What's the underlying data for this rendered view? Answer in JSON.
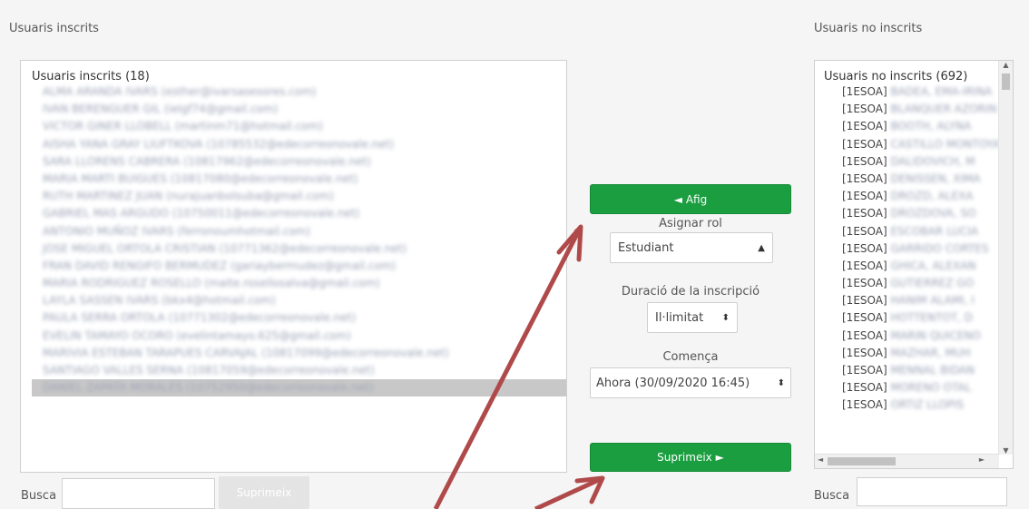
{
  "enrolled": {
    "panel_title": "Usuaris inscrits",
    "list_header": "Usuaris inscrits (18)",
    "items": [
      "ALMA ARANDA IVARS (esther@ivarsasesores.com)",
      "IVAN BERENGUER GIL (ielgf74@gmail.com)",
      "VICTOR GINER LLOBELL (martinm71@hotmail.com)",
      "AISHA YANA GRAY LIUFTKOVA (10785532@edecorreonovale.net)",
      "SARA LLORENS CABRERA (10817962@edecorreonovale.net)",
      "MARIA MARTI BUIGUES (10817080@edecorreonovale.net)",
      "RUTH MARTINEZ JUAN (nurajuanbolsuba@gmail.com)",
      "GABRIEL MAS ARGUDO (10750011@edecorreonovale.net)",
      "ANTONIO MUÑOZ IVARS (ferronoumhotmail.com)",
      "JOSE MIGUEL ORTOLA CRISTIAN (10771362@edecorreonovale.net)",
      "FRAN DAVID RENGIFO BERMUDEZ (gariaybermudez@gmail.com)",
      "MARIA RODRIGUEZ ROSELLO (maite.rosellosalva@gmail.com)",
      "LAYLA SASSEN IVARS (bkx4@hotmail.com)",
      "PAULA SERRA ORTOLA (10771302@edecorreonovale.net)",
      "EVELIN TAMAYO OCORO (evelintamayo.625@gmail.com)",
      "MARIVIA ESTEBAN TARAPUES CARVAJAL (10817099@edecorreonovale.net)",
      "SANTIAGO VALLES SERNA (10817059@edecorreonovale.net)",
      "DANIEL ZAPATA MORALES (10752950@edecorreonovale.net)"
    ],
    "search_label": "Busca",
    "search_value": "",
    "remove_button": "Suprimeix"
  },
  "controls": {
    "add_button": "◄ Afig",
    "role_label": "Asignar rol",
    "role_value": "Estudiant",
    "duration_label": "Duració de la inscripció",
    "duration_value": "Il·limitat",
    "start_label": "Comença",
    "start_value": "Ahora (30/09/2020 16:45)",
    "remove_button": "Suprimeix ►"
  },
  "not_enrolled": {
    "panel_title": "Usuaris no inscrits",
    "list_header": "Usuaris no inscrits (692)",
    "prefix": "[1ESOA]",
    "items": [
      "BADEA, EMA-IRINA",
      "BLANQUER AZORIN",
      "BOOTH, ALYNA",
      "CASTILLO MONTOYA",
      "DALIDOVICH, M",
      "DENISSEN, XIMA",
      "DROZD, ALEXA",
      "DROZDOVA, SO",
      "ESCOBAR LUCIA",
      "GARRIDO CORTES",
      "GHICA, ALEXAN",
      "GUTIERREZ GO",
      "HANIM ALAMI, I",
      "HOTTENTOT, D",
      "MARIN QUICENO",
      "MAZHAR, MUH",
      "MENNAL BIDAN",
      "MORENO OTAL",
      "ORTIZ LLOPIS"
    ],
    "search_label": "Busca",
    "search_value": ""
  },
  "colors": {
    "green": "#1a9e3f",
    "arrow": "#b04a4a"
  }
}
